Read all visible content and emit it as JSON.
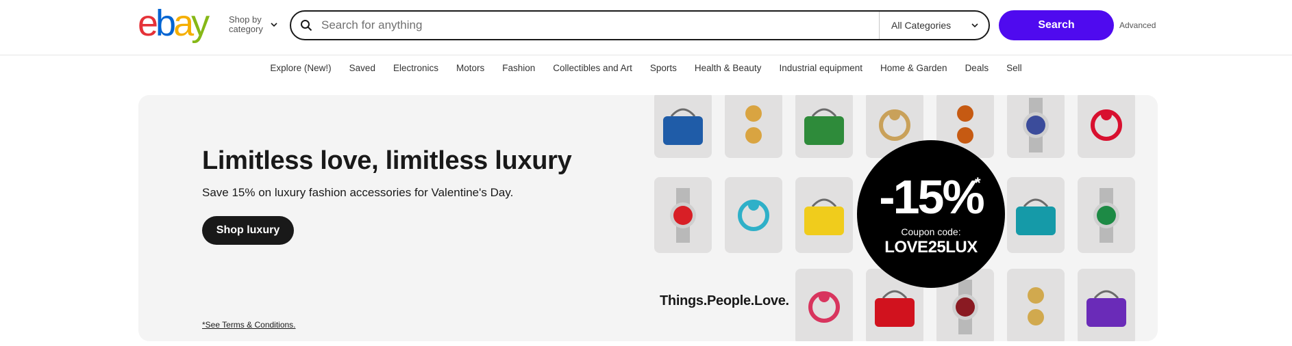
{
  "header": {
    "logo_letters": [
      {
        "char": "e",
        "color": "#e53238"
      },
      {
        "char": "b",
        "color": "#0064d2"
      },
      {
        "char": "a",
        "color": "#f5af02"
      },
      {
        "char": "y",
        "color": "#86b817"
      }
    ],
    "shop_by_category": "Shop by category",
    "search": {
      "placeholder": "Search for anything",
      "value": ""
    },
    "category_select": "All Categories",
    "search_button": "Search",
    "advanced_link": "Advanced",
    "accent_color": "#4f0aef"
  },
  "nav": {
    "items": [
      "Explore (New!)",
      "Saved",
      "Electronics",
      "Motors",
      "Fashion",
      "Collectibles and Art",
      "Sports",
      "Health & Beauty",
      "Industrial equipment",
      "Home & Garden",
      "Deals",
      "Sell"
    ]
  },
  "banner": {
    "headline": "Limitless love, limitless luxury",
    "subline": "Save 15% on luxury fashion accessories for Valentine's Day.",
    "cta": "Shop luxury",
    "terms": "*See Terms & Conditions.",
    "tagline": "Things.People.Love.",
    "promo": {
      "percent": "-15%",
      "star": "*",
      "coupon_label": "Coupon code:",
      "coupon_code": "LOVE25LUX"
    },
    "products": [
      {
        "name": "blue-handbag",
        "color": "#1f5ca8"
      },
      {
        "name": "gold-flower-earrings",
        "color": "#d9a441"
      },
      {
        "name": "green-saddle-bag",
        "color": "#2e8b3a"
      },
      {
        "name": "panther-ring",
        "color": "#c9a15a"
      },
      {
        "name": "amber-stud-earrings",
        "color": "#c65a12"
      },
      {
        "name": "silver-blue-watch",
        "color": "#3b4c9b"
      },
      {
        "name": "ruby-ring",
        "color": "#d8102f"
      },
      {
        "name": "red-dial-watch",
        "color": "#d81f26"
      },
      {
        "name": "turquoise-clover-pendant",
        "color": "#2fb0c8"
      },
      {
        "name": "yellow-bucket-bag",
        "color": "#f0cc1c"
      },
      {
        "name": "teal-quilted-bag",
        "color": "#159aa8"
      },
      {
        "name": "green-dial-watch",
        "color": "#1d8a45"
      },
      {
        "name": "heart-brooch",
        "color": "#d8355e"
      },
      {
        "name": "red-v-pouch",
        "color": "#d1121e"
      },
      {
        "name": "dark-red-watch",
        "color": "#8a1a22"
      },
      {
        "name": "gold-hoop-earrings",
        "color": "#d1a94e"
      },
      {
        "name": "purple-quilted-wallet",
        "color": "#6a2bb8"
      }
    ]
  }
}
